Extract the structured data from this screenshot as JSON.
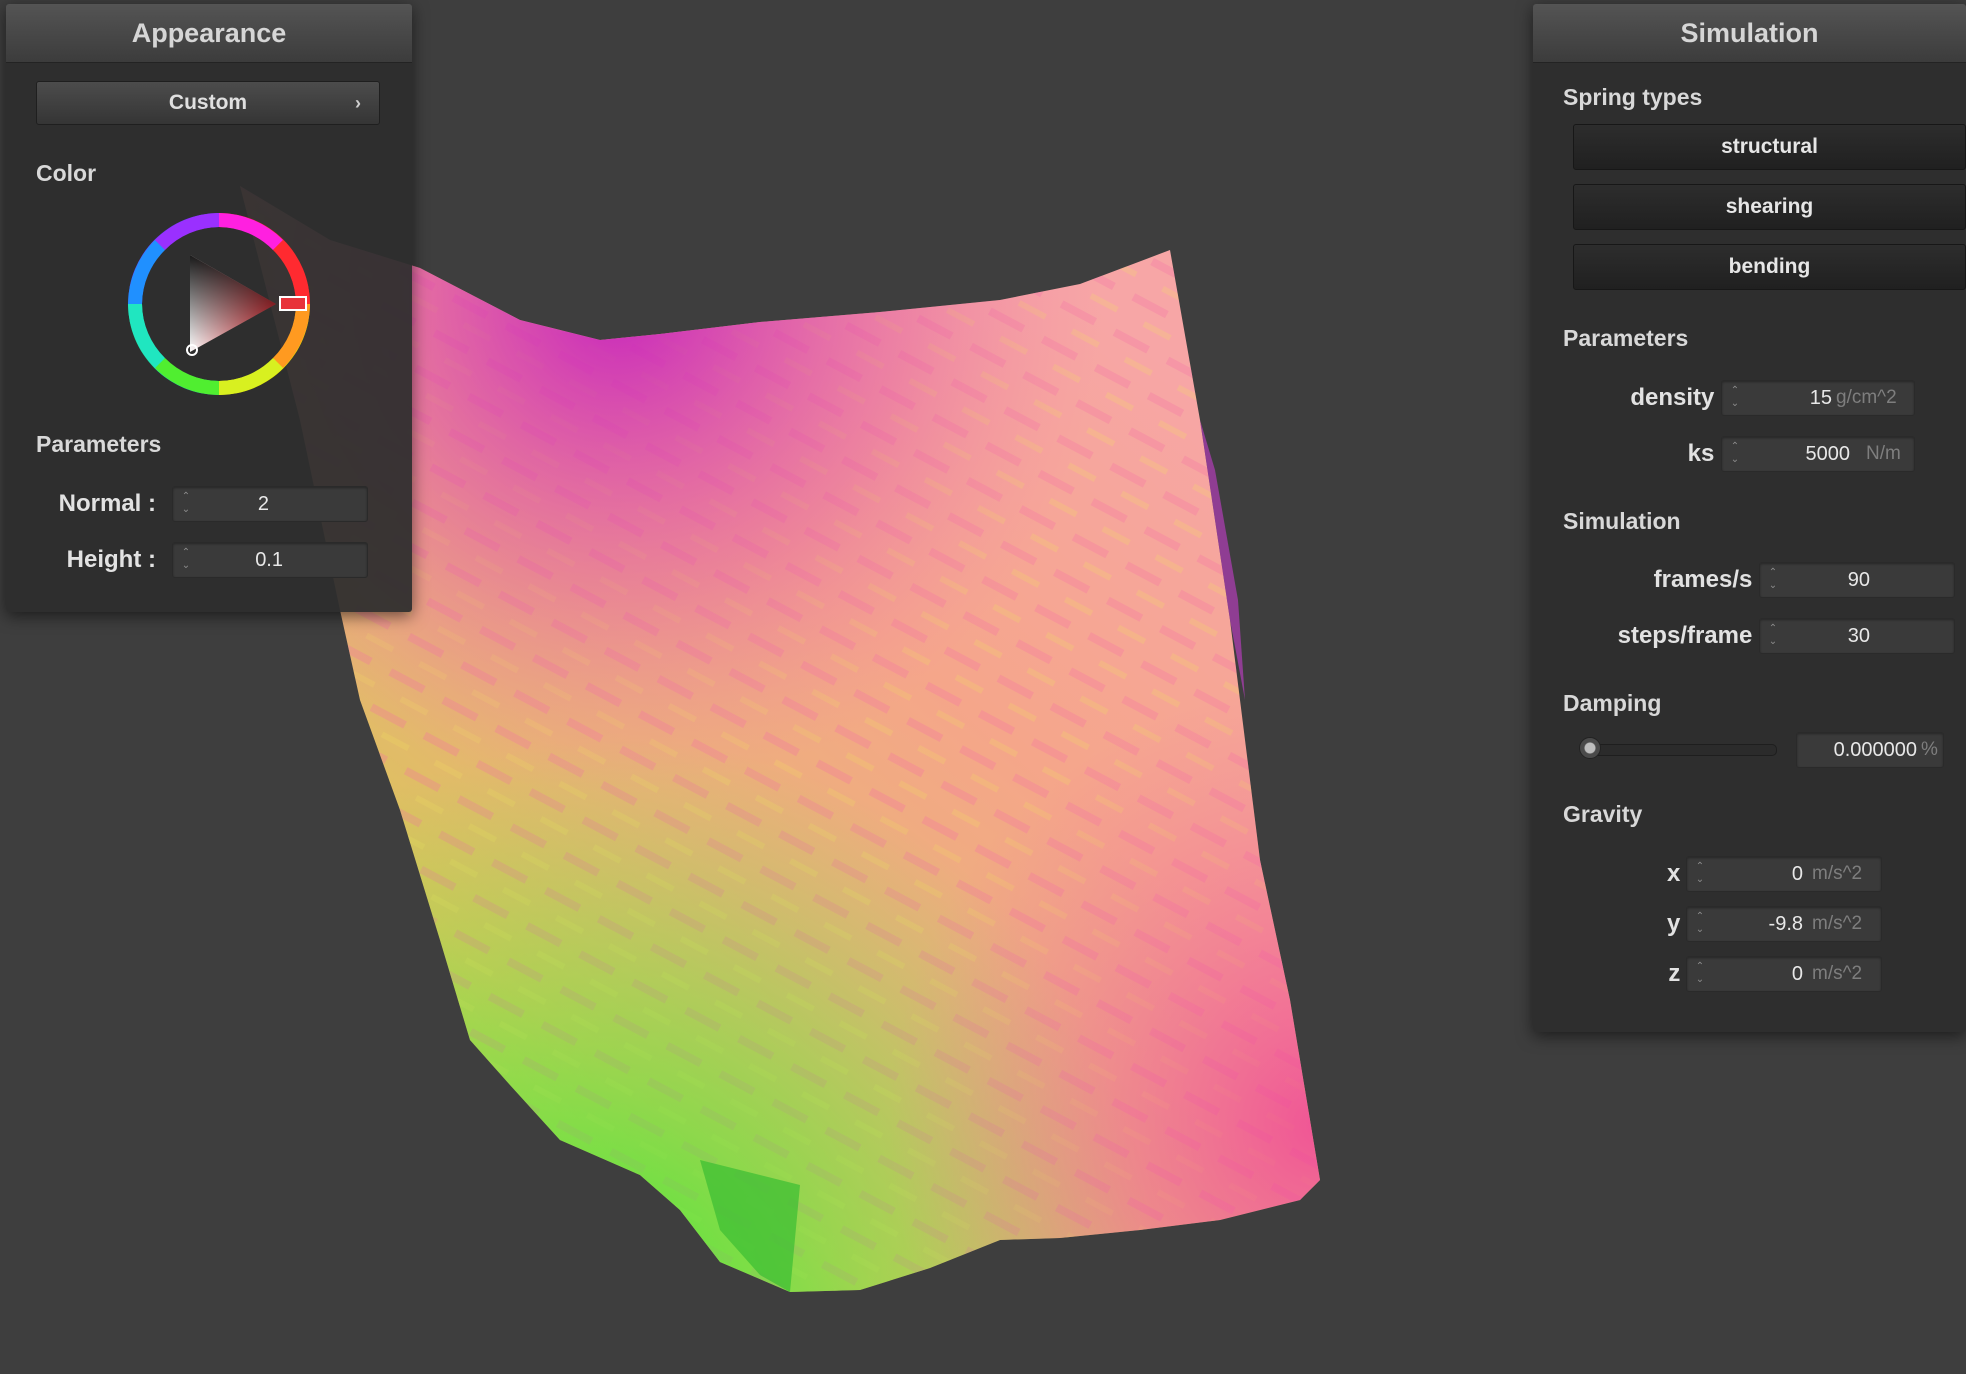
{
  "appearance": {
    "title": "Appearance",
    "preset_label": "Custom",
    "chevron": "›",
    "color_section": "Color",
    "selected_color": "#e8323a",
    "parameters_section": "Parameters",
    "fields": [
      {
        "label": "Normal :",
        "value": "2"
      },
      {
        "label": "Height :",
        "value": "0.1"
      }
    ]
  },
  "simulation": {
    "title": "Simulation",
    "spring_section": "Spring types",
    "spring_buttons": [
      "structural",
      "shearing",
      "bending"
    ],
    "parameters_section": "Parameters",
    "density": {
      "label": "density :",
      "value": "15",
      "unit": "g/cm^2"
    },
    "ks": {
      "label": "ks :",
      "value": "5000",
      "unit": "N/m"
    },
    "simulation_section": "Simulation",
    "frames": {
      "label": "frames/s :",
      "value": "90"
    },
    "steps": {
      "label": "steps/frame :",
      "value": "30"
    },
    "damping_section": "Damping",
    "damping": {
      "value": "0.000000",
      "unit": "%",
      "slider_fraction": 0.0
    },
    "gravity_section": "Gravity",
    "gravity": [
      {
        "label": "x :",
        "value": "0",
        "unit": "m/s^2"
      },
      {
        "label": "y :",
        "value": "-9.8",
        "unit": "m/s^2"
      },
      {
        "label": "z :",
        "value": "0",
        "unit": "m/s^2"
      }
    ]
  },
  "icons": {
    "spinner": "spinner-arrows-icon",
    "chevron": "chevron-right-icon"
  }
}
